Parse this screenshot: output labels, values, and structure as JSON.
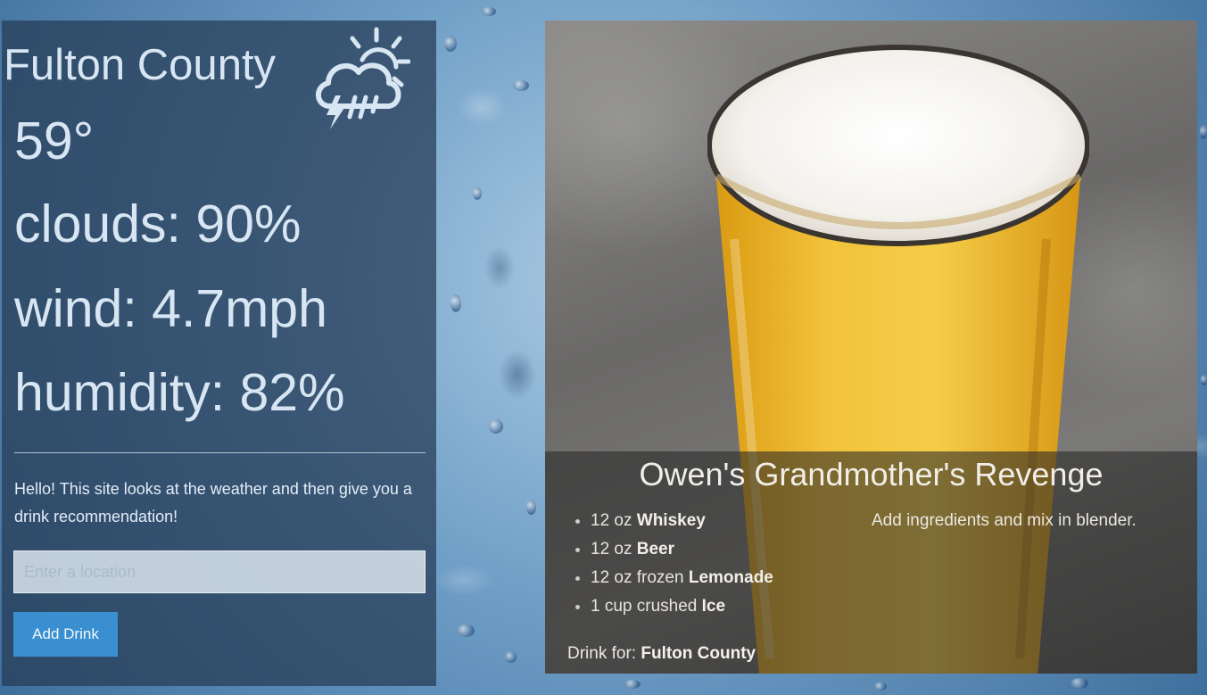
{
  "weather": {
    "city": "Fulton County",
    "icon": "thunderstorm-partly-sunny-icon",
    "temperature": "59°",
    "clouds": "clouds: 90%",
    "wind": "wind: 4.7mph",
    "humidity": "humidity: 82%"
  },
  "intro": {
    "text": "Hello! This site looks at the weather and then give you a drink recommendation!"
  },
  "search": {
    "placeholder": "Enter a location",
    "value": ""
  },
  "actions": {
    "add_drink_label": "Add Drink"
  },
  "drink": {
    "name": "Owen's Grandmother's Revenge",
    "ingredients": [
      {
        "amount": "12 oz",
        "name": "Whiskey"
      },
      {
        "amount": "12 oz",
        "name": "Beer"
      },
      {
        "amount": "12 oz frozen",
        "name": "Lemonade"
      },
      {
        "amount": "1 cup crushed",
        "name": "Ice"
      }
    ],
    "instructions": "Add ingredients and mix in blender.",
    "for_label": "Drink for:",
    "for_location": "Fulton County"
  },
  "colors": {
    "button": "#3a8fd0",
    "panel": "#263a54",
    "beer": "#e9b52a"
  }
}
